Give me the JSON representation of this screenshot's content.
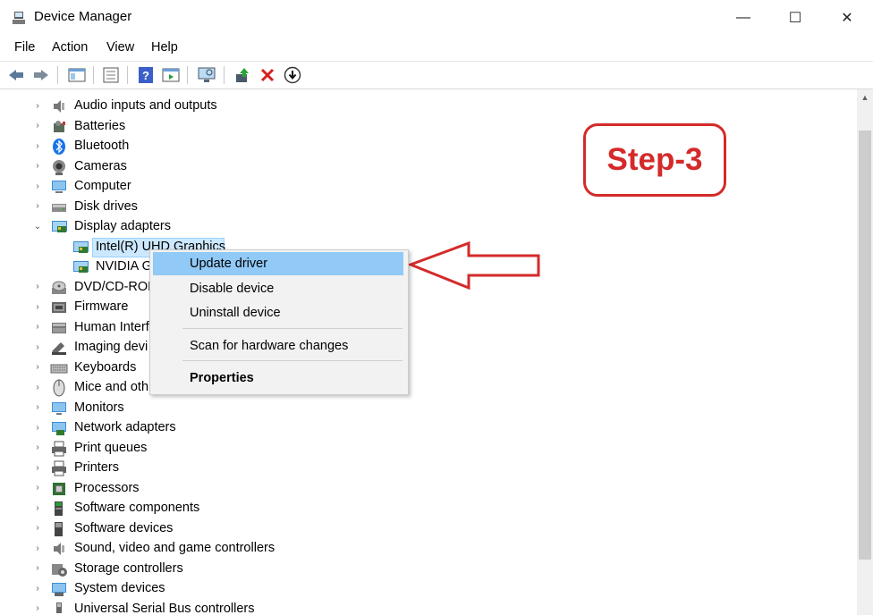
{
  "window": {
    "title": "Device Manager",
    "minimize": "—",
    "maximize": "☐",
    "close": "✕"
  },
  "menu": [
    "File",
    "Action",
    "View",
    "Help"
  ],
  "tree": [
    {
      "label": "Audio inputs and outputs",
      "chev": "›",
      "icon": "speaker-icon"
    },
    {
      "label": "Batteries",
      "chev": "›",
      "icon": "battery-icon"
    },
    {
      "label": "Bluetooth",
      "chev": "›",
      "icon": "bluetooth-icon"
    },
    {
      "label": "Cameras",
      "chev": "›",
      "icon": "camera-icon"
    },
    {
      "label": "Computer",
      "chev": "›",
      "icon": "computer-icon"
    },
    {
      "label": "Disk drives",
      "chev": "›",
      "icon": "disk-icon"
    },
    {
      "label": "Display adapters",
      "chev": "⌄",
      "icon": "display-adapter-icon"
    },
    {
      "label": "Intel(R) UHD Graphics",
      "child": true,
      "icon": "display-adapter-icon"
    },
    {
      "label": "NVIDIA G",
      "child": true,
      "icon": "display-adapter-icon"
    },
    {
      "label": "DVD/CD-ROM",
      "chev": "›",
      "icon": "dvd-icon"
    },
    {
      "label": "Firmware",
      "chev": "›",
      "icon": "firmware-icon"
    },
    {
      "label": "Human Interf",
      "chev": "›",
      "icon": "hid-icon"
    },
    {
      "label": "Imaging devi",
      "chev": "›",
      "icon": "imaging-icon"
    },
    {
      "label": "Keyboards",
      "chev": "›",
      "icon": "keyboard-icon"
    },
    {
      "label": "Mice and oth",
      "chev": "›",
      "icon": "mouse-icon"
    },
    {
      "label": "Monitors",
      "chev": "›",
      "icon": "monitor-icon"
    },
    {
      "label": "Network adapters",
      "chev": "›",
      "icon": "network-icon"
    },
    {
      "label": "Print queues",
      "chev": "›",
      "icon": "printer-icon"
    },
    {
      "label": "Printers",
      "chev": "›",
      "icon": "printer-icon"
    },
    {
      "label": "Processors",
      "chev": "›",
      "icon": "processor-icon"
    },
    {
      "label": "Software components",
      "chev": "›",
      "icon": "software-component-icon"
    },
    {
      "label": "Software devices",
      "chev": "›",
      "icon": "software-device-icon"
    },
    {
      "label": "Sound, video and game controllers",
      "chev": "›",
      "icon": "speaker-icon"
    },
    {
      "label": "Storage controllers",
      "chev": "›",
      "icon": "storage-icon"
    },
    {
      "label": "System devices",
      "chev": "›",
      "icon": "system-icon"
    },
    {
      "label": "Universal Serial Bus controllers",
      "chev": "›",
      "icon": "usb-icon"
    }
  ],
  "context_menu": {
    "update": "Update driver",
    "disable": "Disable device",
    "uninstall": "Uninstall device",
    "scan": "Scan for hardware changes",
    "properties": "Properties"
  },
  "annotation": {
    "step": "Step-3",
    "color": "#d42a2a"
  },
  "colors": {
    "highlight": "#91c9f7",
    "selected": "#cce8ff"
  }
}
